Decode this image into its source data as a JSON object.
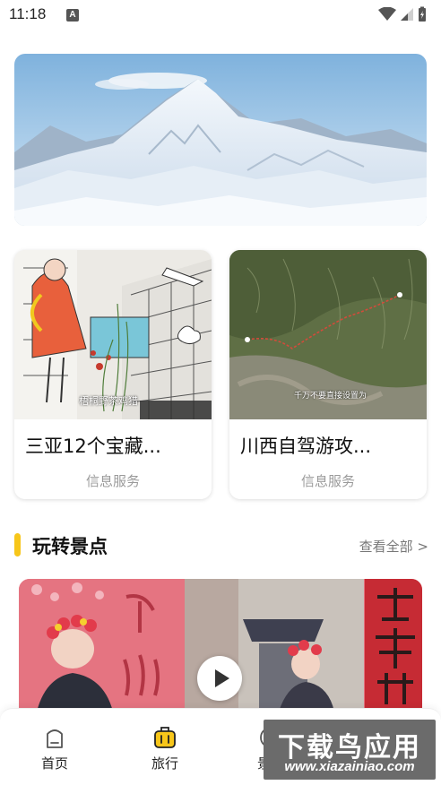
{
  "status_bar": {
    "time": "11:18",
    "notification_icon": "A"
  },
  "banner": {
    "image": "snow-mountain-photo"
  },
  "cards": [
    {
      "image": "illustration-city-girl",
      "image_caption": "梧桐野茶鸡猎",
      "title": "三亚12个宝藏...",
      "subtitle": "信息服务"
    },
    {
      "image": "satellite-terrain-map",
      "image_caption": "千万不要直接设置为",
      "title": "川西自驾游攻...",
      "subtitle": "信息服务"
    }
  ],
  "section": {
    "title": "玩转景点",
    "more_label": "查看全部 >"
  },
  "scenic": {
    "image": "chinese-costume-video-thumbnail",
    "play_icon": "play-icon"
  },
  "bottom_nav": {
    "items": [
      {
        "label": "首页",
        "icon": "home-icon"
      },
      {
        "label": "旅行",
        "icon": "suitcase-icon"
      },
      {
        "label": "景社",
        "icon": "compass-icon"
      }
    ]
  },
  "watermark": {
    "title": "下载鸟应用",
    "url": "www.xiazainiao.com"
  },
  "colors": {
    "accent": "#f7c61a",
    "muted_text": "#9a9a9a"
  }
}
